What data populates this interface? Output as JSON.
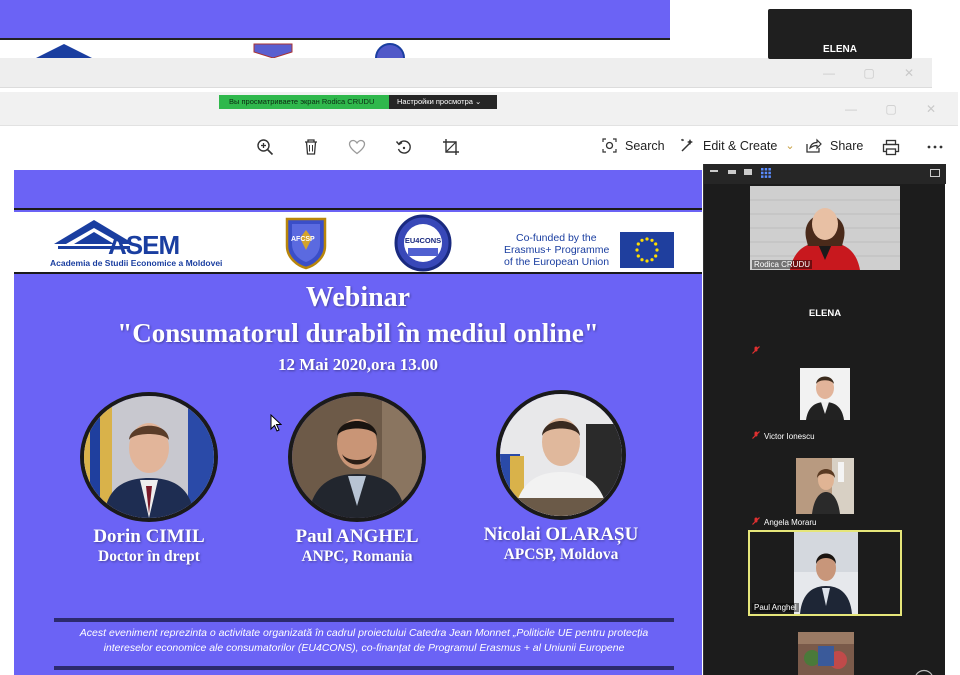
{
  "share_banner": {
    "message": "Вы просматриваете экран Rodica CRUDU",
    "options_label": "Настройки просмотра"
  },
  "background_tile": {
    "name": "ELENA"
  },
  "toolbar": {
    "search_label": "Search",
    "edit_label": "Edit & Create",
    "share_label": "Share"
  },
  "slide": {
    "asem_logo_text": "ASEM",
    "asem_subtitle": "Academia de Studii Economice a Moldovei",
    "afcsp_logo_text": "AFCSP",
    "eu4cons_logo_text": "EU4CONS",
    "cofunded_line1": "Co-funded by the",
    "cofunded_line2": "Erasmus+ Programme",
    "cofunded_line3": "of the European Union",
    "title": "Webinar",
    "subtitle": "\"Consumatorul durabil în mediul online\"",
    "date": "12 Mai 2020,ora 13.00",
    "speakers": [
      {
        "name": "Dorin CIMIL",
        "role": "Doctor în drept"
      },
      {
        "name": "Paul ANGHEL",
        "role": "ANPC, Romania"
      },
      {
        "name": "Nicolai OLARAȘU",
        "role": "APCSP, Moldova"
      }
    ],
    "footer_line1": "Acest eveniment reprezinta o activitate organizată în cadrul proiectului  Catedra Jean Monnet „Politicile UE pentru protecția",
    "footer_line2": "intereselor economice ale consumatorilor (EU4CONS), co-finanțat de Programul Erasmus + al Uniunii Europene"
  },
  "participants": [
    {
      "name": "Rodica CRUDU",
      "active": false
    },
    {
      "name": "ELENA",
      "active": false
    },
    {
      "name": "Victor Ionescu",
      "active": false
    },
    {
      "name": "Angela Moraru",
      "active": false
    },
    {
      "name": "Paul Anghel",
      "active": true
    }
  ],
  "colors": {
    "slide_bg": "#6b63f5",
    "asem_blue": "#1a3ea0",
    "panel_bg": "#1c1c1c",
    "active_border": "#e6e67a",
    "banner_green": "#2fb84c"
  }
}
